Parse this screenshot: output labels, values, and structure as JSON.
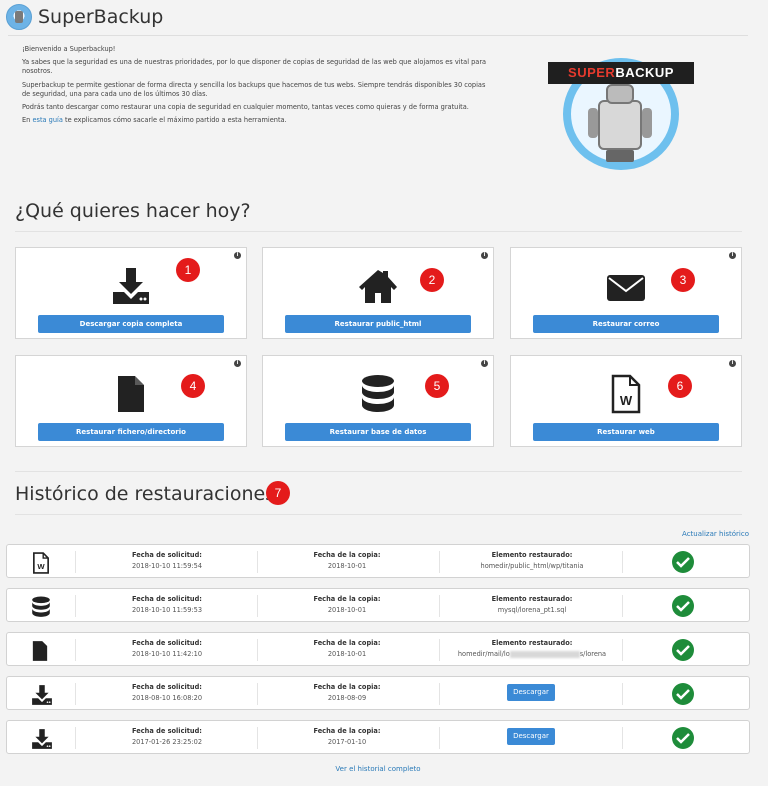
{
  "app": {
    "title": "SuperBackup"
  },
  "intro": {
    "p1": "¡Bienvenido a Superbackup!",
    "p2": "Ya sabes que la seguridad es una de nuestras prioridades, por lo que disponer de copias de seguridad de las web que alojamos es vital para nosotros.",
    "p3": "Superbackup te permite gestionar de forma directa y sencilla los backups que hacemos de tus webs. Siempre tendrás disponibles 30 copias de seguridad, una para cada uno de los últimos 30 días.",
    "p4": "Podrás tanto descargar como restaurar una copia de seguridad en cualquier momento, tantas veces como quieras y de forma gratuita.",
    "p5_before": "En ",
    "p5_link": "esta guía",
    "p5_after": " te explicamos cómo sacarle el máximo partido a esta herramienta."
  },
  "brand": {
    "super": "SUPER",
    "backup": "BACKUP"
  },
  "actions": {
    "title": "¿Qué quieres hacer hoy?",
    "info_glyph": "i",
    "cards": [
      {
        "num": "1",
        "label": "Descargar copia completa",
        "icon": "download-icon"
      },
      {
        "num": "2",
        "label": "Restaurar public_html",
        "icon": "home-icon"
      },
      {
        "num": "3",
        "label": "Restaurar correo",
        "icon": "envelope-icon"
      },
      {
        "num": "4",
        "label": "Restaurar fichero/directorio",
        "icon": "file-icon"
      },
      {
        "num": "5",
        "label": "Restaurar base de datos",
        "icon": "database-icon"
      },
      {
        "num": "6",
        "label": "Restaurar web",
        "icon": "word-file-icon"
      }
    ]
  },
  "history": {
    "title": "Histórico de restauraciones",
    "num": "7",
    "update_link": "Actualizar histórico",
    "labels": {
      "request": "Fecha de solicitud:",
      "copy": "Fecha de la copia:",
      "element": "Elemento restaurado:"
    },
    "download_label": "Descargar",
    "rows": [
      {
        "icon": "word-file-icon",
        "request": "2018-10-10 11:59:54",
        "copy": "2018-10-01",
        "element": "homedir/public_html/wp/titania"
      },
      {
        "icon": "database-icon",
        "request": "2018-10-10 11:59:53",
        "copy": "2018-10-01",
        "element": "mysql/lorena_pt1.sql"
      },
      {
        "icon": "file-icon",
        "request": "2018-10-10 11:42:10",
        "copy": "2018-10-01",
        "element_start": "homedir/mail/lo",
        "element_end": "s/lorena"
      },
      {
        "icon": "download-icon",
        "request": "2018-08-10 16:08:20",
        "copy": "2018-08-09"
      },
      {
        "icon": "download-icon",
        "request": "2017-01-26 23:25:02",
        "copy": "2017-01-10"
      }
    ],
    "more_link": "Ver el historial completo"
  },
  "colors": {
    "accent": "#3b8ad6",
    "badge": "#e41b1b",
    "success": "#1e8c3a"
  }
}
